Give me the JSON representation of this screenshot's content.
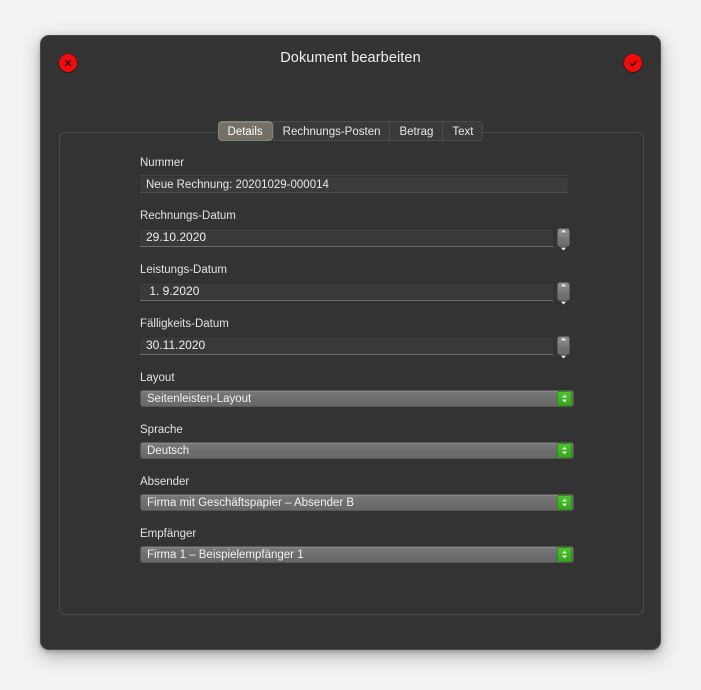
{
  "window": {
    "title": "Dokument bearbeiten",
    "close_button": "close-icon",
    "accept_button": "checkmark-icon"
  },
  "tabs": [
    {
      "label": "Details",
      "selected": true
    },
    {
      "label": "Rechnungs-Posten",
      "selected": false
    },
    {
      "label": "Betrag",
      "selected": false
    },
    {
      "label": "Text",
      "selected": false
    }
  ],
  "form": {
    "nummer": {
      "label": "Nummer",
      "value": "Neue Rechnung: 20201029-000014"
    },
    "rechnungs_datum": {
      "label": "Rechnungs-Datum",
      "value": "29.10.2020"
    },
    "leistungs_datum": {
      "label": "Leistungs-Datum",
      "value": " 1. 9.2020"
    },
    "faelligkeits_datum": {
      "label": "Fälligkeits-Datum",
      "value": "30.11.2020"
    },
    "layout": {
      "label": "Layout",
      "value": "Seitenleisten-Layout"
    },
    "sprache": {
      "label": "Sprache",
      "value": "Deutsch"
    },
    "absender": {
      "label": "Absender",
      "value": "Firma mit Geschäftspapier – Absender B"
    },
    "empfaenger": {
      "label": "Empfänger",
      "value": "Firma 1 – Beispielempfänger 1"
    }
  },
  "colors": {
    "window_bg": "#333333",
    "accent_red": "#f50b0b",
    "accent_green": "#3aad1e",
    "select_bg": "#6e6e6e",
    "selected_tab": "#757067"
  }
}
